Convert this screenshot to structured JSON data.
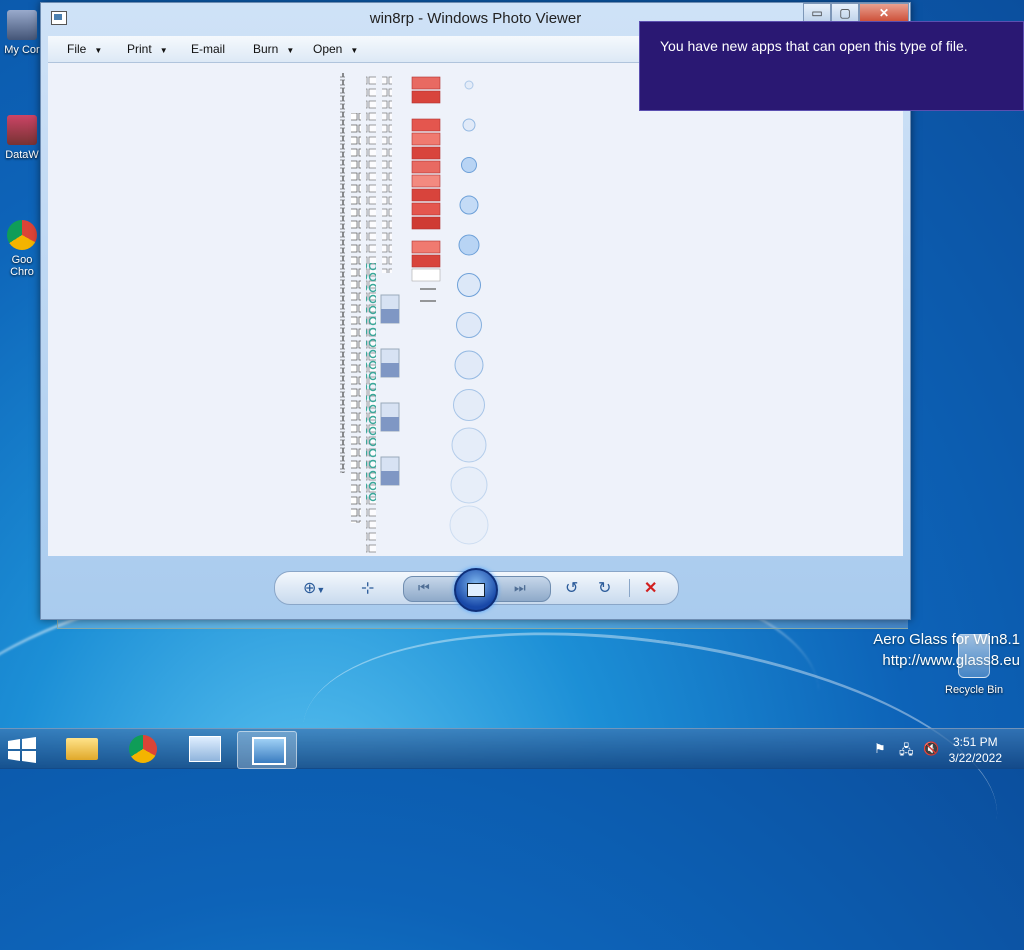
{
  "window": {
    "title": "win8rp - Windows Photo Viewer",
    "min_label": "▭",
    "max_label": "▢",
    "close_label": "✕"
  },
  "menu": [
    {
      "label": "File",
      "has_arrow": true
    },
    {
      "label": "Print",
      "has_arrow": true
    },
    {
      "label": "E-mail",
      "has_arrow": false
    },
    {
      "label": "Burn",
      "has_arrow": true
    },
    {
      "label": "Open",
      "has_arrow": true
    }
  ],
  "toolbar": {
    "zoom_icon": "zoom-icon",
    "fit_icon": "actual-size-icon",
    "prev_icon": "previous-icon",
    "slideshow_icon": "slideshow-icon",
    "next_icon": "next-icon",
    "rotate_ccw_icon": "rotate-ccw-icon",
    "rotate_cw_icon": "rotate-cw-icon",
    "delete_icon": "delete-icon"
  },
  "toast": {
    "message": "You have new apps that can open this type of file."
  },
  "desktop_icons": [
    {
      "label": "My Cor",
      "icon": "computer-icon"
    },
    {
      "label": "DataW",
      "icon": "datawin-icon"
    },
    {
      "label": "Goo Chro",
      "icon": "chrome-icon"
    }
  ],
  "watermark": {
    "line1": "Aero Glass for Win8.1",
    "line2": "http://www.glass8.eu"
  },
  "recycle_bin": {
    "label": "Recycle Bin"
  },
  "clock": {
    "time": "3:51 PM",
    "date": "3/22/2022"
  },
  "colors": {
    "toast_bg": "#2a1873",
    "accent_blue": "#1848a8",
    "delete_red": "#d21f1f"
  }
}
